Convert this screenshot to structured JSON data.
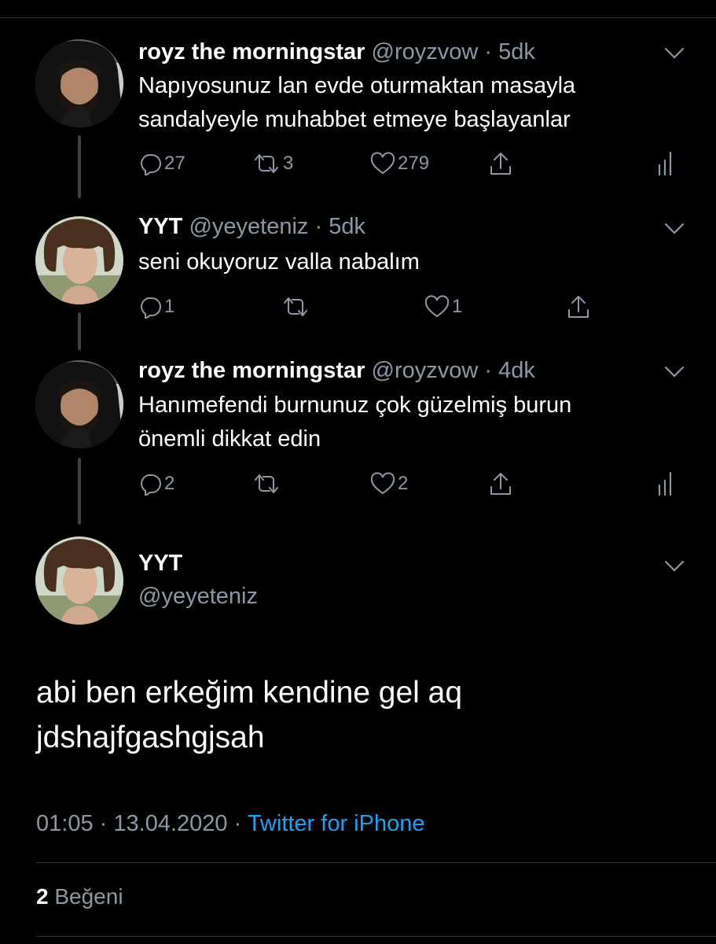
{
  "colors": {
    "background": "#000000",
    "text": "#ffffff",
    "muted": "#8b98a5",
    "accent": "#1da1f2",
    "divider": "#2f3336"
  },
  "tweets": [
    {
      "name": "royz the morningstar",
      "handle": "@royzvow",
      "dot": "·",
      "time": "5dk",
      "lines": [
        "Napıyosunuz lan evde oturmaktan masayla",
        "sandalyeyle muhabbet etmeye başlayanlar"
      ],
      "reply_count": "27",
      "retweet_count": "3",
      "like_count": "279",
      "avatar": "bearded-man-hood"
    },
    {
      "name": "YYT",
      "handle": "@yeyeteniz",
      "dot": "·",
      "time": "5dk",
      "lines": [
        "seni okuyoruz valla nabalım"
      ],
      "reply_count": "1",
      "retweet_count": "",
      "like_count": "1",
      "avatar": "curly-hair-person"
    },
    {
      "name": "royz the morningstar",
      "handle": "@royzvow",
      "dot": "·",
      "time": "4dk",
      "lines": [
        "Hanımefendi burnunuz çok güzelmiş burun",
        "önemli dikkat edin"
      ],
      "reply_count": "2",
      "retweet_count": "",
      "like_count": "2",
      "avatar": "bearded-man-hood"
    }
  ],
  "main_tweet": {
    "name": "YYT",
    "handle": "@yeyeteniz",
    "lines": [
      "abi ben erkeğim kendine gel aq",
      "jdshajfgashgjsah"
    ],
    "time": "01:05",
    "dot": "·",
    "date": "13.04.2020",
    "dot2": "·",
    "source": "Twitter for iPhone",
    "like_count": "2",
    "like_label": "Beğeni",
    "avatar": "curly-hair-person"
  },
  "icons": [
    "reply-icon",
    "retweet-icon",
    "like-icon",
    "share-icon",
    "analytics-icon",
    "chevron-down-icon"
  ]
}
